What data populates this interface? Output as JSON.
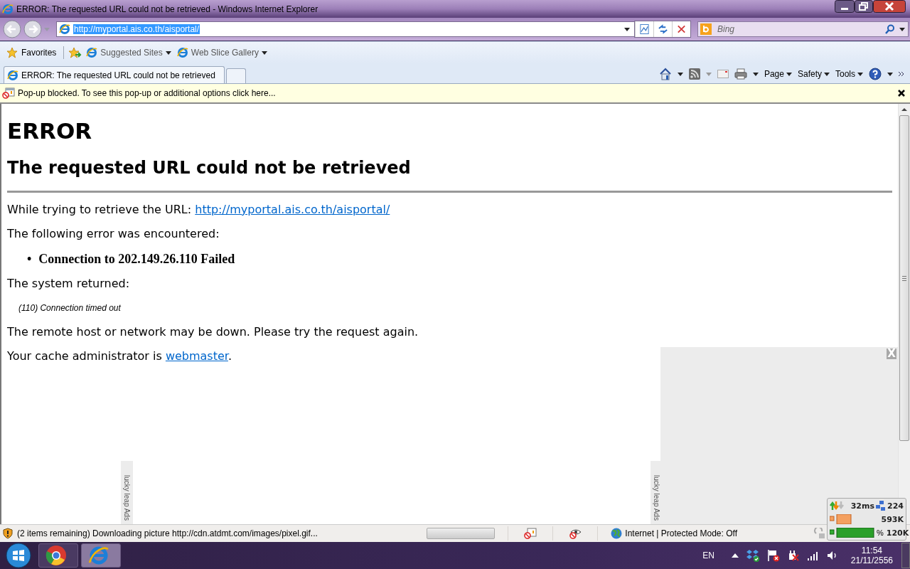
{
  "window": {
    "title": "ERROR: The requested URL could not be retrieved - Windows Internet Explorer"
  },
  "address_bar": {
    "url": "http://myportal.ais.co.th/aisportal/",
    "selected": true
  },
  "search": {
    "placeholder": "Bing"
  },
  "favorites_bar": {
    "favorites": "Favorites",
    "items": [
      {
        "label": "Suggested Sites"
      },
      {
        "label": "Web Slice Gallery"
      }
    ]
  },
  "tabs": [
    {
      "label": "ERROR: The requested URL could not be retrieved",
      "selected": true
    }
  ],
  "command_bar": {
    "menus": [
      "Page",
      "Safety",
      "Tools"
    ]
  },
  "info_bar": {
    "text": "Pop-up blocked. To see this pop-up or additional options click here..."
  },
  "page": {
    "heading": "ERROR",
    "subheading": "The requested URL could not be retrieved",
    "blocks": [
      {
        "kind": "link_text",
        "text": "While trying to retrieve the URL: ",
        "link": "http://myportal.ais.co.th/aisportal/"
      },
      {
        "kind": "text",
        "text": "The following error was encountered:"
      },
      {
        "kind": "bullet",
        "marker": "•",
        "text": "Connection to 202.149.26.110 Failed"
      },
      {
        "kind": "text",
        "text": "The system returned:"
      },
      {
        "kind": "code",
        "text": "(110) Connection timed out"
      },
      {
        "kind": "text",
        "text": "The remote host or network may be down. Please try the request again."
      },
      {
        "kind": "link_text",
        "text": "Your cache administrator is ",
        "link": "webmaster",
        "after": "."
      }
    ]
  },
  "ads": {
    "close": "X",
    "strips": [
      {
        "label": "lucky leap Ads"
      },
      {
        "label": "lucky leap Ads"
      }
    ]
  },
  "net_meter": {
    "latency": "32ms",
    "count": "224",
    "memory": "593K",
    "percent": "%",
    "traffic": "120K"
  },
  "status_bar": {
    "text": "(2 items remaining) Downloading picture http://cdn.atdmt.com/images/pixel.gif...",
    "progress": {
      "level": 0
    },
    "zone": "Internet | Protected Mode: Off"
  },
  "taskbar": {
    "apps": [
      {
        "kind": "chrome",
        "selected": false
      },
      {
        "kind": "ie",
        "selected": true
      }
    ],
    "language": "EN",
    "time": "11:54",
    "date": "21/11/2556"
  }
}
